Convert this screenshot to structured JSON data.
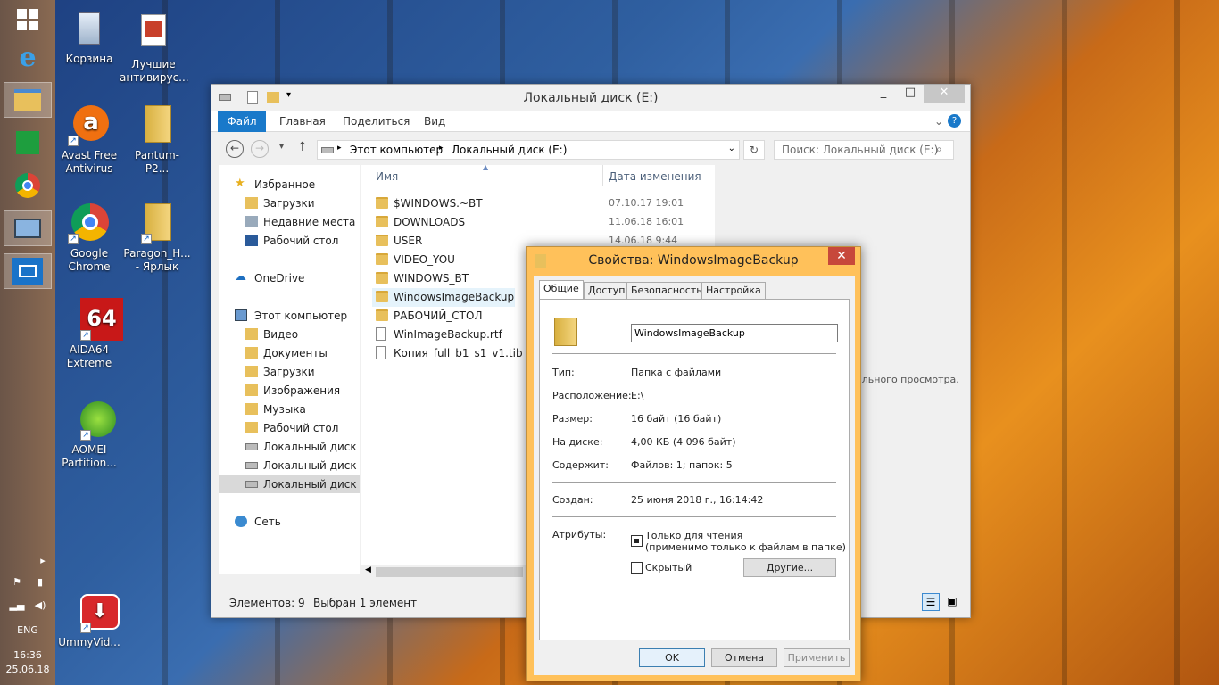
{
  "desktop": {
    "icons": [
      {
        "label": "Корзина"
      },
      {
        "label": "Лучшие антивирус..."
      },
      {
        "label": "Avast Free Antivirus"
      },
      {
        "label": "Pantum-P2..."
      },
      {
        "label": "Google Chrome"
      },
      {
        "label": "Paragon_H... - Ярлык"
      },
      {
        "label": "AIDA64 Extreme"
      },
      {
        "label": "AOMEI Partition..."
      },
      {
        "label": "UmmyVid..."
      }
    ],
    "aida_badge": "64"
  },
  "taskbar": {
    "lang": "ENG",
    "time": "16:36",
    "date": "25.06.18"
  },
  "explorer": {
    "title": "Локальный диск (E:)",
    "ribbon_tabs": [
      "Файл",
      "Главная",
      "Поделиться",
      "Вид"
    ],
    "breadcrumb": [
      "Этот компьютер",
      "Локальный диск (E:)"
    ],
    "search_placeholder": "Поиск: Локальный диск (E:)",
    "nav": [
      "Избранное",
      "Загрузки",
      "Недавние места",
      "Рабочий стол",
      "OneDrive",
      "Этот компьютер",
      "Видео",
      "Документы",
      "Загрузки",
      "Изображения",
      "Музыка",
      "Рабочий стол",
      "Локальный диск (C",
      "Локальный диск (D",
      "Локальный диск (E:",
      "Сеть"
    ],
    "columns": {
      "name": "Имя",
      "date": "Дата изменения"
    },
    "files": [
      {
        "name": "$WINDOWS.~BT",
        "date": "07.10.17 19:01"
      },
      {
        "name": "DOWNLOADS",
        "date": "11.06.18 16:01"
      },
      {
        "name": "USER",
        "date": "14.06.18 9:44"
      },
      {
        "name": "VIDEO_YOU",
        "date": ""
      },
      {
        "name": "WINDOWS_BT",
        "date": ""
      },
      {
        "name": "WindowsImageBackup",
        "date": ""
      },
      {
        "name": "РАБОЧИЙ_СТОЛ",
        "date": ""
      },
      {
        "name": "WinImageBackup.rtf",
        "date": ""
      },
      {
        "name": "Копия_full_b1_s1_v1.tib",
        "date": ""
      }
    ],
    "preview_text": "ального просмотра.",
    "status_count": "Элементов: 9",
    "status_selected": "Выбран 1 элемент"
  },
  "dialog": {
    "title": "Свойства: WindowsImageBackup",
    "tabs": [
      "Общие",
      "Доступ",
      "Безопасность",
      "Настройка"
    ],
    "name_value": "WindowsImageBackup",
    "props": [
      {
        "label": "Тип:",
        "value": "Папка с файлами"
      },
      {
        "label": "Расположение:",
        "value": "E:\\"
      },
      {
        "label": "Размер:",
        "value": "16 байт (16 байт)"
      },
      {
        "label": "На диске:",
        "value": "4,00 КБ (4 096 байт)"
      },
      {
        "label": "Содержит:",
        "value": "Файлов: 1; папок: 5"
      }
    ],
    "created_label": "Создан:",
    "created_value": "25 июня 2018 г., 16:14:42",
    "attributes_label": "Атрибуты:",
    "readonly_label": "Только для чтения",
    "readonly_note": "(применимо только к файлам в папке)",
    "hidden_label": "Скрытый",
    "other_button": "Другие...",
    "ok": "OK",
    "cancel": "Отмена",
    "apply": "Применить"
  }
}
